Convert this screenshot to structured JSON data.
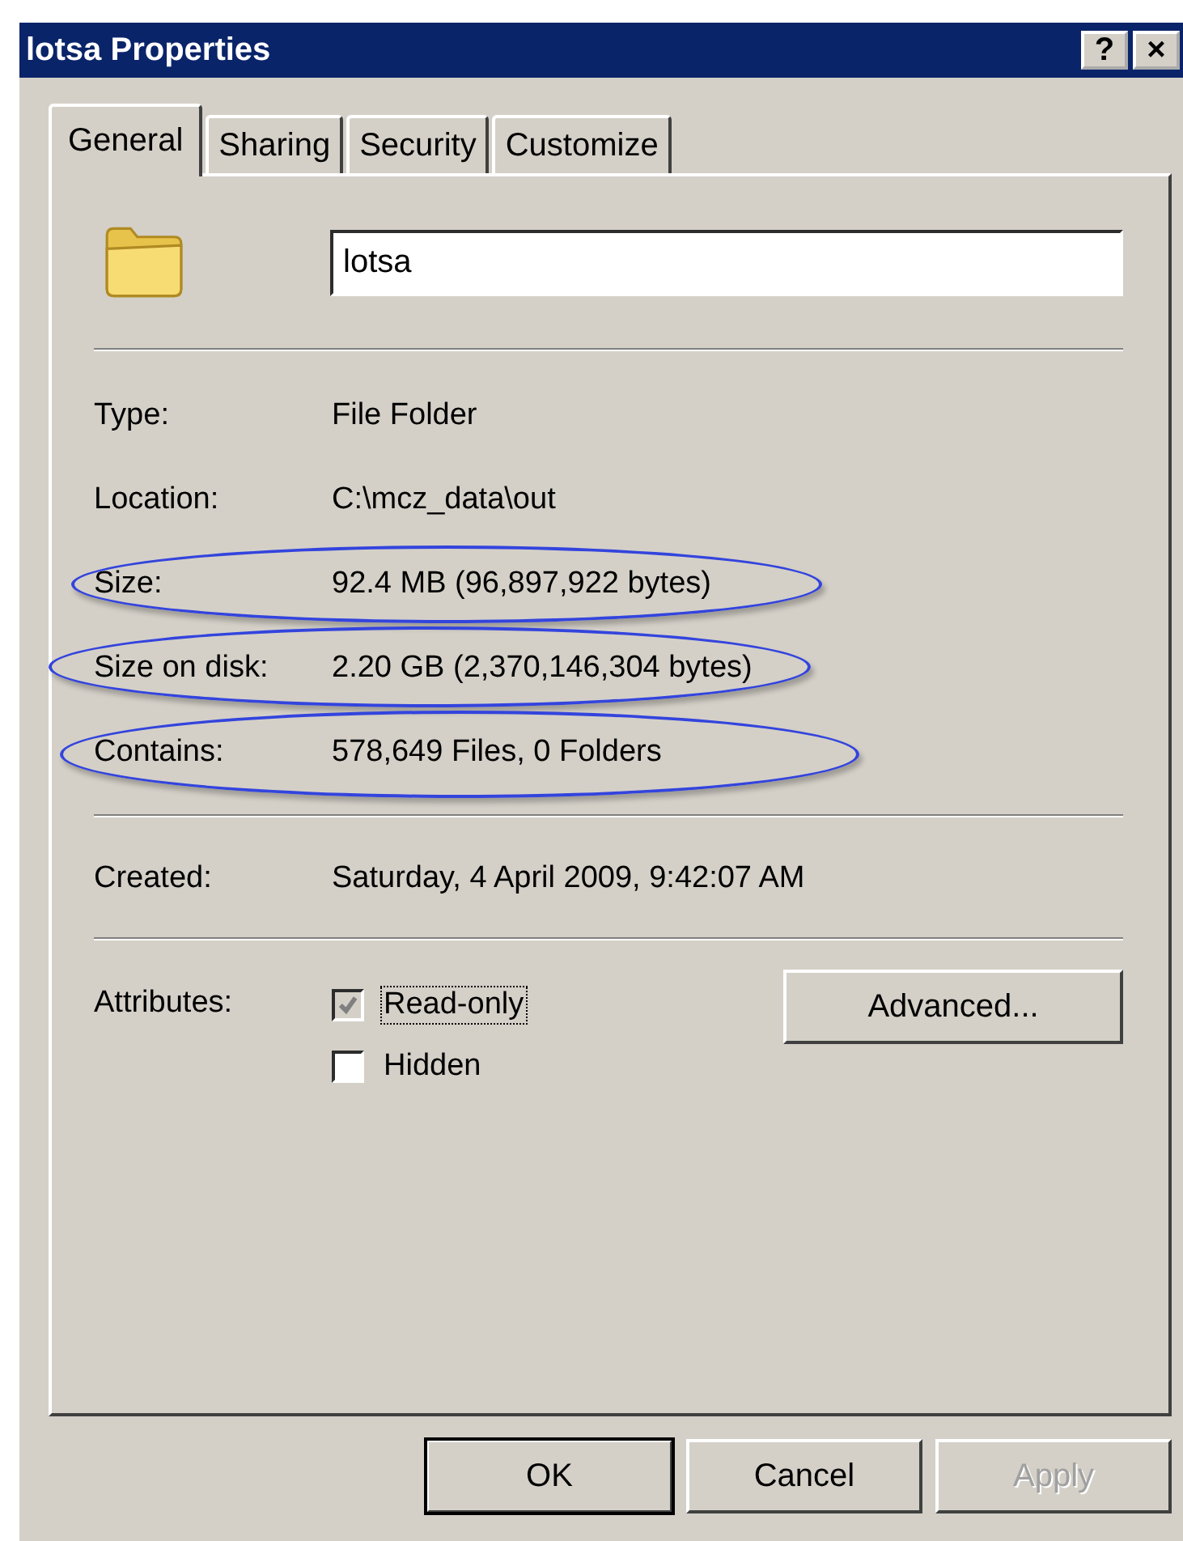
{
  "window": {
    "title": "lotsa Properties",
    "title_buttons": [
      "?",
      "×"
    ]
  },
  "tabs": [
    {
      "label": "General",
      "selected": true
    },
    {
      "label": "Sharing",
      "selected": false
    },
    {
      "label": "Security",
      "selected": false
    },
    {
      "label": "Customize",
      "selected": false
    }
  ],
  "name_field": {
    "value": "lotsa"
  },
  "sections": [
    {
      "rows": [
        {
          "label": "Type:",
          "value": "File Folder",
          "circled": false
        },
        {
          "label": "Location:",
          "value": "C:\\mcz_data\\out",
          "circled": false
        },
        {
          "label": "Size:",
          "value": "92.4 MB (96,897,922 bytes)",
          "circled": true
        },
        {
          "label": "Size on disk:",
          "value": "2.20 GB (2,370,146,304 bytes)",
          "circled": true
        },
        {
          "label": "Contains:",
          "value": "578,649 Files, 0 Folders",
          "circled": true
        }
      ]
    },
    {
      "rows": [
        {
          "label": "Created:",
          "value": "Saturday, 4 April 2009, 9:42:07 AM",
          "circled": false
        }
      ]
    }
  ],
  "attributes": {
    "label": "Attributes:",
    "checkboxes": [
      {
        "label": "Read-only",
        "checked": true,
        "disabled": true,
        "focused": true
      },
      {
        "label": "Hidden",
        "checked": false,
        "disabled": false,
        "focused": false
      }
    ],
    "advanced_button": "Advanced..."
  },
  "buttons": [
    {
      "label": "OK",
      "default": true,
      "disabled": false
    },
    {
      "label": "Cancel",
      "default": false,
      "disabled": false
    },
    {
      "label": "Apply",
      "default": false,
      "disabled": true
    }
  ]
}
